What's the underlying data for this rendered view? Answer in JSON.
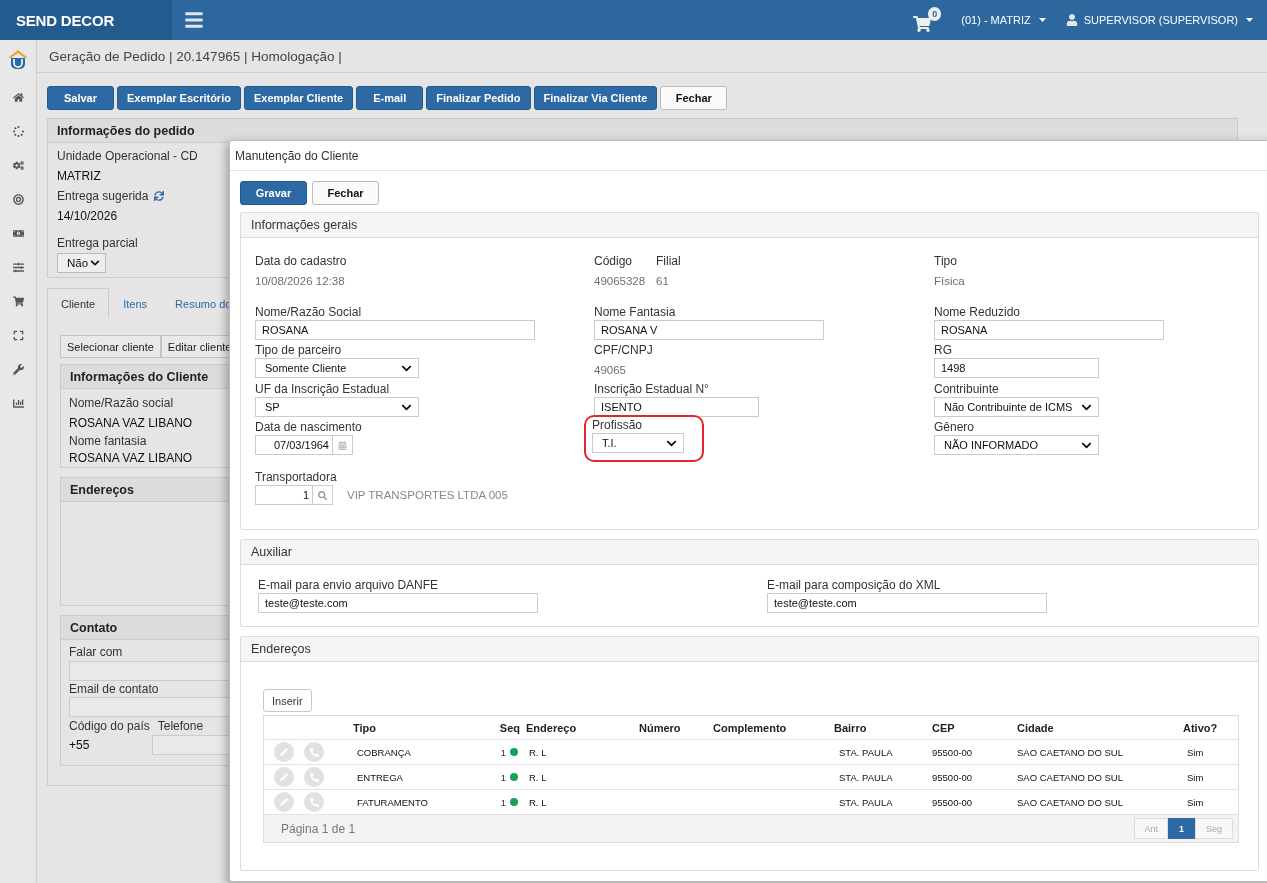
{
  "topbar": {
    "brand": "SEND DECOR",
    "cart_count": "0",
    "branch": "(01) - MATRIZ",
    "user": "SUPERVISOR (SUPERVISOR)"
  },
  "page": {
    "title": "Geração de Pedido | 20.147965 | Homologação |",
    "toolbar": [
      {
        "label": "Salvar",
        "kind": "primary"
      },
      {
        "label": "Exemplar Escritório",
        "kind": "primary"
      },
      {
        "label": "Exemplar Cliente",
        "kind": "primary"
      },
      {
        "label": "E-mail",
        "kind": "primary"
      },
      {
        "label": "Finalizar Pedido",
        "kind": "primary"
      },
      {
        "label": "Finalizar Via Cliente",
        "kind": "primary"
      },
      {
        "label": "Fechar",
        "kind": "default"
      }
    ],
    "order_panel": {
      "title": "Informações do pedido",
      "unit_label": "Unidade Operacional - CD",
      "unit_value": "MATRIZ",
      "delivery_label": "Entrega sugerida",
      "delivery_date": "14/10/2026",
      "partial_label": "Entrega parcial",
      "partial_value": "Não"
    },
    "tabs": [
      {
        "label": "Cliente",
        "selected": true
      },
      {
        "label": "Itens",
        "selected": false
      },
      {
        "label": "Resumo do",
        "selected": false
      }
    ],
    "client_buttons": [
      "Selecionar cliente",
      "Editar cliente"
    ],
    "client_panel": {
      "title": "Informações do Cliente",
      "fields": [
        {
          "label": "Nome/Razão social",
          "value": "ROSANA VAZ LIBANO"
        },
        {
          "label": "Nome fantasia",
          "value": "ROSANA VAZ LIBANO"
        }
      ]
    },
    "addresses_panel": {
      "title": "Endereços"
    },
    "contact_panel": {
      "title": "Contato",
      "talk_label": "Falar com",
      "email_label": "Email de contato",
      "country_label": "Código do país",
      "phone_label": "Telefone",
      "country_value": "+55"
    }
  },
  "modal": {
    "title": "Manutenção do Cliente",
    "buttons": [
      {
        "label": "Gravar",
        "kind": "primary"
      },
      {
        "label": "Fechar",
        "kind": "default"
      }
    ],
    "general": {
      "title": "Informações gerais",
      "columns": [
        [
          {
            "kind": "static",
            "label": "Data do cadastro",
            "value": "10/08/2026 12:38",
            "highlighted": false
          },
          {
            "kind": "input",
            "label": "Nome/Razão Social",
            "value": "ROSANA",
            "highlighted": false
          },
          {
            "kind": "select",
            "label": "Tipo de parceiro",
            "value": "Somente Cliente",
            "highlighted": false
          },
          {
            "kind": "select",
            "label": "UF da Inscrição Estadual",
            "value": "SP",
            "highlighted": false
          },
          {
            "kind": "date",
            "label": "Data de nascimento",
            "value": "07/03/1964",
            "highlighted": false
          },
          {
            "kind": "lookup",
            "label": "Transportadora",
            "value": "1",
            "description": "VIP TRANSPORTES LTDA 005",
            "highlighted": false
          }
        ],
        [
          {
            "kind": "static_pair",
            "parts": [
              {
                "label": "Código",
                "value": "49065328"
              },
              {
                "label": "Filial",
                "value": "61"
              }
            ],
            "highlighted": false
          },
          {
            "kind": "input",
            "label": "Nome Fantasia",
            "value": "ROSANA V",
            "highlighted": false
          },
          {
            "kind": "static",
            "label": "CPF/CNPJ",
            "value": "49065",
            "highlighted": false
          },
          {
            "kind": "input",
            "label": "Inscrição Estadual N°",
            "value": "ISENTO",
            "highlighted": false
          },
          {
            "kind": "select",
            "label": "Profissão",
            "value": "T.I.",
            "highlighted": true
          }
        ],
        [
          {
            "kind": "static",
            "label": "Tipo",
            "value": "Física",
            "highlighted": false
          },
          {
            "kind": "input",
            "label": "Nome Reduzido",
            "value": "ROSANA",
            "highlighted": false
          },
          {
            "kind": "input",
            "label": "RG",
            "value": "1498",
            "highlighted": false
          },
          {
            "kind": "select",
            "label": "Contribuinte",
            "value": "Não Contribuinte de ICMS",
            "highlighted": false
          },
          {
            "kind": "select",
            "label": "Gênero",
            "value": "NÃO INFORMADO",
            "highlighted": false
          }
        ]
      ]
    },
    "auxiliary": {
      "title": "Auxiliar",
      "fields": [
        {
          "label": "E-mail para envio arquivo DANFE",
          "value": "teste@teste.com"
        },
        {
          "label": "E-mail para composição do XML",
          "value": "teste@teste.com"
        }
      ]
    },
    "addresses": {
      "title": "Endereços",
      "insert_button": "Inserir",
      "columns": [
        "Tipo",
        "Seq",
        "Endereço",
        "Número",
        "Complemento",
        "Bairro",
        "CEP",
        "Cidade",
        "Ativo?"
      ],
      "rows": [
        {
          "tipo": "COBRANÇA",
          "seq": "1",
          "color": "#16a05a",
          "endereco": "R. L",
          "bairro": "STA. PAULA",
          "cep": "95500-00",
          "cidade": "SAO CAETANO DO SUL",
          "ativo": "Sim"
        },
        {
          "tipo": "ENTREGA",
          "seq": "1",
          "color": "#16a05a",
          "endereco": "R. L",
          "bairro": "STA. PAULA",
          "cep": "95500-00",
          "cidade": "SAO CAETANO DO SUL",
          "ativo": "Sim"
        },
        {
          "tipo": "FATURAMENTO",
          "seq": "1",
          "color": "#16a05a",
          "endereco": "R. L",
          "bairro": "STA. PAULA",
          "cep": "95500-00",
          "cidade": "SAO CAETANO DO SUL",
          "ativo": "Sim"
        }
      ],
      "footer": "Página 1 de 1",
      "pagination": {
        "prev": {
          "label": "Ant",
          "disabled": true
        },
        "pages": [
          {
            "label": "1",
            "selected": true
          }
        ],
        "next": {
          "label": "Seg",
          "disabled": true
        }
      }
    }
  }
}
